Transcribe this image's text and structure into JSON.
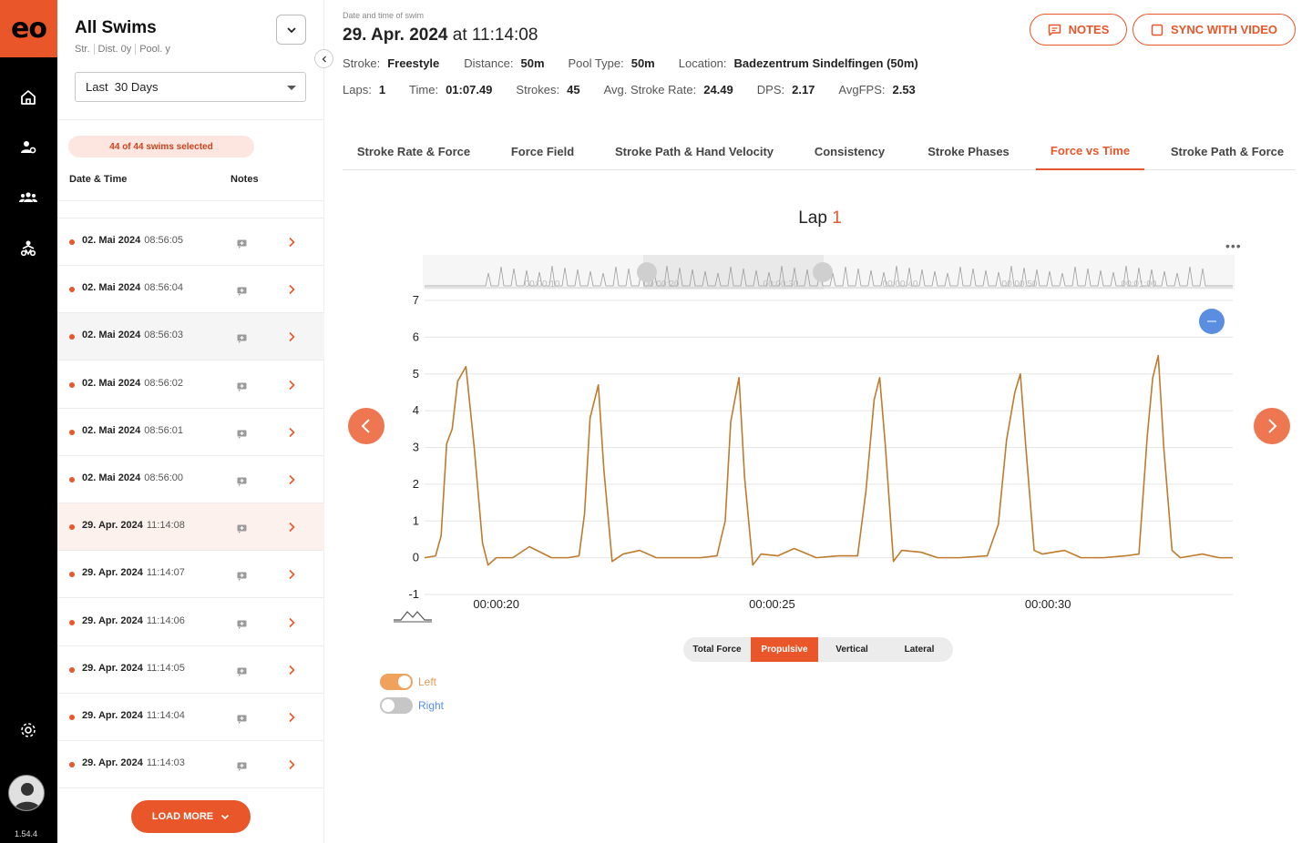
{
  "app": {
    "logo": "eo",
    "version": "1.54.4"
  },
  "rail": {
    "icons": [
      "home-icon",
      "user-settings-icon",
      "group-icon",
      "swimmers-icon",
      "settings-icon"
    ]
  },
  "panel": {
    "title": "All Swims",
    "sub": [
      "Str.",
      "Dist. 0y",
      "Pool. y"
    ],
    "range": "Last  30 Days",
    "selected": "44 of 44 swims selected",
    "col_date": "Date & Time",
    "col_notes": "Notes",
    "rows": [
      {
        "date": "02. Mai 2024",
        "time": "08:56:05"
      },
      {
        "date": "02. Mai 2024",
        "time": "08:56:04"
      },
      {
        "date": "02. Mai 2024",
        "time": "08:56:03"
      },
      {
        "date": "02. Mai 2024",
        "time": "08:56:02"
      },
      {
        "date": "02. Mai 2024",
        "time": "08:56:01"
      },
      {
        "date": "02. Mai 2024",
        "time": "08:56:00"
      },
      {
        "date": "29. Apr. 2024",
        "time": "11:14:08"
      },
      {
        "date": "29. Apr. 2024",
        "time": "11:14:07"
      },
      {
        "date": "29. Apr. 2024",
        "time": "11:14:06"
      },
      {
        "date": "29. Apr. 2024",
        "time": "11:14:05"
      },
      {
        "date": "29. Apr. 2024",
        "time": "11:14:04"
      },
      {
        "date": "29. Apr. 2024",
        "time": "11:14:03"
      }
    ],
    "load_more": "LOAD MORE"
  },
  "swim": {
    "caption": "Date and time of swim",
    "date": "29. Apr. 2024",
    "at": "at 11:14:08",
    "stroke_k": "Stroke:",
    "stroke_v": "Freestyle",
    "distance_k": "Distance:",
    "distance_v": "50m",
    "pool_k": "Pool Type:",
    "pool_v": "50m",
    "location_k": "Location:",
    "location_v": "Badezentrum Sindelfingen (50m)",
    "laps_k": "Laps:",
    "laps_v": "1",
    "time_k": "Time:",
    "time_v": "01:07.49",
    "strokes_k": "Strokes:",
    "strokes_v": "45",
    "rate_k": "Avg. Stroke Rate:",
    "rate_v": "24.49",
    "dps_k": "DPS:",
    "dps_v": "2.17",
    "fps_k": "AvgFPS:",
    "fps_v": "2.53"
  },
  "buttons": {
    "notes": "NOTES",
    "sync": "SYNC WITH VIDEO"
  },
  "tabs": [
    "Stroke Rate & Force",
    "Force Field",
    "Stroke Path & Hand Velocity",
    "Consistency",
    "Stroke Phases",
    "Force vs Time",
    "Stroke Path & Force"
  ],
  "lap": {
    "label": "Lap",
    "num": "1"
  },
  "overview_ticks": [
    "00:00:10",
    "00:00:20",
    "00:00:30",
    "00:00:40",
    "00:00:50",
    "00:01:00"
  ],
  "force_types": [
    "Total Force",
    "Propulsive",
    "Vertical",
    "Lateral"
  ],
  "force_selected": "Propulsive",
  "hands": {
    "left": "Left",
    "right": "Right",
    "left_on": true,
    "right_on": false
  },
  "colors": {
    "accent": "#e8562a",
    "line": "#bd7b2e",
    "blue": "#5b8ee0"
  },
  "chart_data": {
    "type": "line",
    "xlabel": "",
    "ylabel": "",
    "ylim": [
      -1,
      7
    ],
    "yticks": [
      -1,
      0,
      1,
      2,
      3,
      4,
      5,
      6,
      7
    ],
    "xlim": [
      18.7,
      33.35
    ],
    "xticks": [
      20,
      25,
      30
    ],
    "xtick_labels": [
      "00:00:20",
      "00:00:25",
      "00:00:30"
    ],
    "peaks": [
      {
        "t": 19.45,
        "value": 5.2
      },
      {
        "t": 21.85,
        "value": 4.7
      },
      {
        "t": 24.4,
        "value": 4.9
      },
      {
        "t": 26.95,
        "value": 4.9
      },
      {
        "t": 29.5,
        "value": 5.0
      },
      {
        "t": 32.0,
        "value": 5.5
      }
    ],
    "series": [
      {
        "name": "Left",
        "t": [
          18.7,
          18.9,
          19.0,
          19.1,
          19.2,
          19.3,
          19.45,
          19.6,
          19.75,
          19.85,
          20.0,
          20.3,
          20.6,
          21.0,
          21.3,
          21.5,
          21.6,
          21.7,
          21.85,
          21.95,
          22.1,
          22.3,
          22.6,
          22.9,
          23.3,
          23.7,
          24.0,
          24.15,
          24.25,
          24.4,
          24.5,
          24.65,
          24.8,
          25.1,
          25.4,
          25.8,
          26.2,
          26.55,
          26.7,
          26.85,
          26.95,
          27.05,
          27.2,
          27.35,
          27.7,
          28.0,
          28.4,
          28.9,
          29.1,
          29.25,
          29.4,
          29.5,
          29.6,
          29.75,
          29.9,
          30.3,
          30.6,
          31.0,
          31.4,
          31.65,
          31.8,
          31.9,
          32.0,
          32.1,
          32.25,
          32.4,
          32.8,
          33.1,
          33.35
        ],
        "values": [
          0.0,
          0.05,
          0.6,
          3.1,
          3.5,
          4.8,
          5.2,
          3.0,
          0.4,
          -0.2,
          0.0,
          0.0,
          0.3,
          0.0,
          0.0,
          0.05,
          1.2,
          3.8,
          4.7,
          2.4,
          -0.1,
          0.1,
          0.2,
          0.0,
          0.0,
          0.0,
          0.05,
          1.0,
          3.7,
          4.9,
          2.2,
          -0.2,
          0.1,
          0.05,
          0.25,
          0.0,
          0.05,
          0.05,
          1.8,
          4.3,
          4.9,
          3.1,
          -0.1,
          0.2,
          0.15,
          0.0,
          0.0,
          0.05,
          0.9,
          3.2,
          4.5,
          5.0,
          3.0,
          0.2,
          0.1,
          0.2,
          0.0,
          0.0,
          0.05,
          0.1,
          3.3,
          4.9,
          5.5,
          3.0,
          0.2,
          0.0,
          0.1,
          0.0,
          0.0
        ]
      }
    ]
  }
}
